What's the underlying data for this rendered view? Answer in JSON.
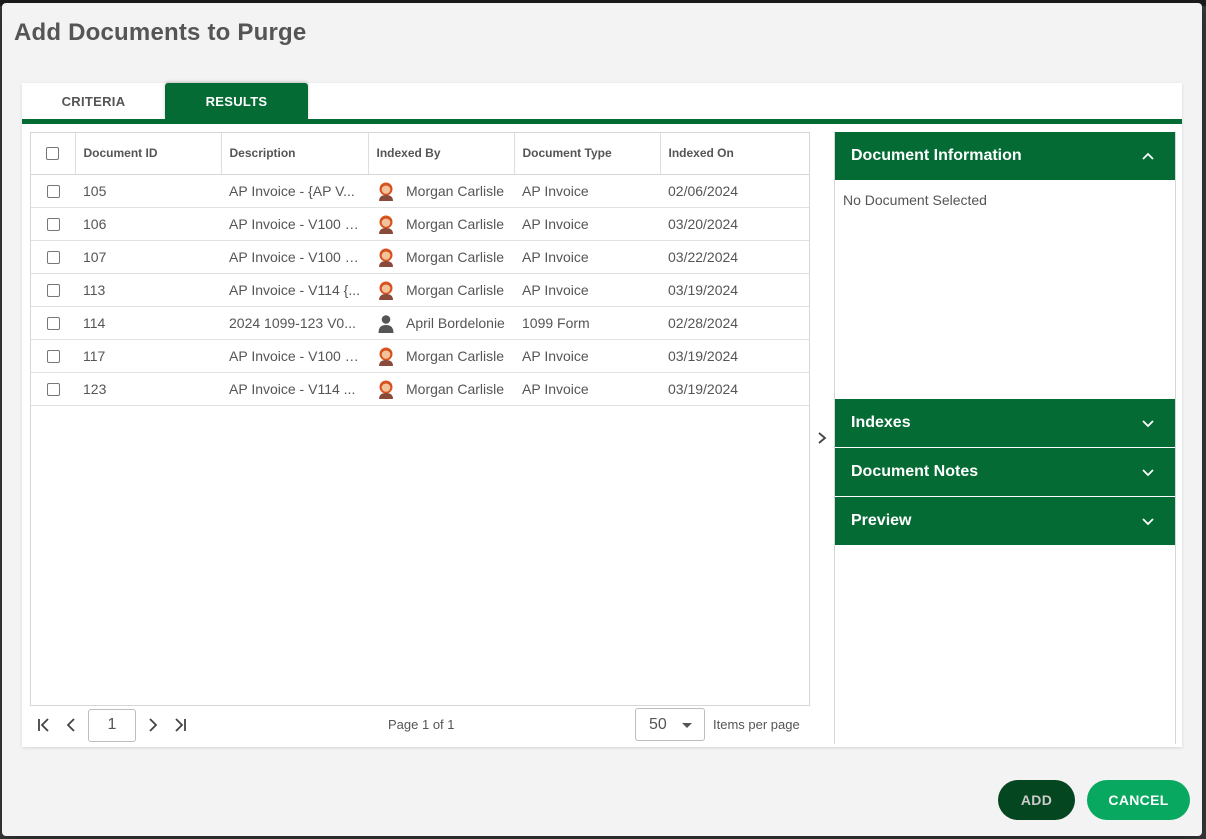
{
  "dialog": {
    "title": "Add Documents to Purge"
  },
  "tabs": [
    {
      "label": "CRITERIA",
      "active": false
    },
    {
      "label": "RESULTS",
      "active": true
    }
  ],
  "table": {
    "columns": [
      "Document ID",
      "Description",
      "Indexed By",
      "Document Type",
      "Indexed On"
    ],
    "rows": [
      {
        "id": "105",
        "description": "AP Invoice - {AP V...",
        "indexed_by": "Morgan Carlisle",
        "avatar": "female-avatar",
        "type": "AP Invoice",
        "indexed_on": "02/06/2024"
      },
      {
        "id": "106",
        "description": "AP Invoice - V100 {...",
        "indexed_by": "Morgan Carlisle",
        "avatar": "female-avatar",
        "type": "AP Invoice",
        "indexed_on": "03/20/2024"
      },
      {
        "id": "107",
        "description": "AP Invoice - V100 {...",
        "indexed_by": "Morgan Carlisle",
        "avatar": "female-avatar",
        "type": "AP Invoice",
        "indexed_on": "03/22/2024"
      },
      {
        "id": "113",
        "description": "AP Invoice - V114 {...",
        "indexed_by": "Morgan Carlisle",
        "avatar": "female-avatar",
        "type": "AP Invoice",
        "indexed_on": "03/19/2024"
      },
      {
        "id": "114",
        "description": "2024 1099-123 V0...",
        "indexed_by": "April Bordelonie",
        "avatar": "generic-user",
        "type": "1099 Form",
        "indexed_on": "02/28/2024"
      },
      {
        "id": "117",
        "description": "AP Invoice - V100 {...",
        "indexed_by": "Morgan Carlisle",
        "avatar": "female-avatar",
        "type": "AP Invoice",
        "indexed_on": "03/19/2024"
      },
      {
        "id": "123",
        "description": "AP Invoice - V114 ...",
        "indexed_by": "Morgan Carlisle",
        "avatar": "female-avatar",
        "type": "AP Invoice",
        "indexed_on": "03/19/2024"
      }
    ]
  },
  "pager": {
    "current_page": "1",
    "page_info": "Page 1 of 1",
    "items_per_page": "50",
    "items_per_page_label": "Items per page"
  },
  "side_panel": {
    "document_information": {
      "title": "Document Information",
      "body": "No Document Selected",
      "expanded": true
    },
    "indexes": {
      "title": "Indexes",
      "expanded": false
    },
    "document_notes": {
      "title": "Document Notes",
      "expanded": false
    },
    "preview": {
      "title": "Preview",
      "expanded": false
    }
  },
  "buttons": {
    "add": "ADD",
    "cancel": "CANCEL"
  },
  "colors": {
    "brand_green": "#056b35",
    "add_button": "#04461f",
    "cancel_button": "#08a860"
  }
}
